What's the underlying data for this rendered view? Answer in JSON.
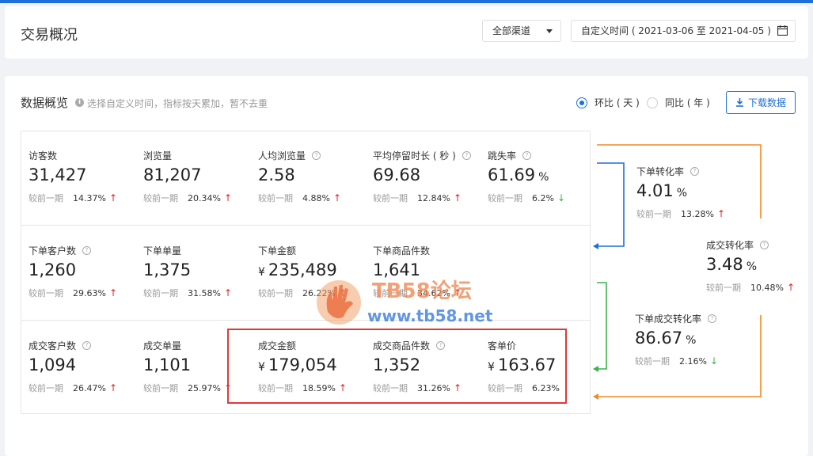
{
  "header": {
    "title": "交易概况",
    "channel": "全部渠道",
    "date_range": "自定义时间 ( 2021-03-06 至 2021-04-05 )"
  },
  "overview": {
    "title": "数据概览",
    "hint": "选择自定义时间，指标按天累加，暂不去重",
    "radio_ring": "环比 ( 天 )",
    "radio_year": "同比 ( 年 )",
    "download": "下载数据"
  },
  "compare_label": "较前一期",
  "metrics": [
    {
      "label": "访客数",
      "value": "31,427",
      "pct": "14.37%",
      "trend": "up",
      "help": false
    },
    {
      "label": "浏览量",
      "value": "81,207",
      "pct": "20.34%",
      "trend": "up",
      "help": false
    },
    {
      "label": "人均浏览量",
      "value": "2.58",
      "pct": "4.88%",
      "trend": "up",
      "help": true
    },
    {
      "label": "平均停留时长 ( 秒 )",
      "value": "69.68",
      "pct": "12.84%",
      "trend": "up",
      "help": true
    },
    {
      "label": "跳失率",
      "value": "61.69",
      "unit": "%",
      "pct": "6.2%",
      "trend": "down",
      "help": true
    },
    {
      "label": "下单客户数",
      "value": "1,260",
      "pct": "29.63%",
      "trend": "up",
      "help": true
    },
    {
      "label": "下单单量",
      "value": "1,375",
      "pct": "31.58%",
      "trend": "up",
      "help": false
    },
    {
      "label": "下单金额",
      "value": "235,489",
      "currency": "¥",
      "pct": "26.22%",
      "trend": "up",
      "help": false
    },
    {
      "label": "下单商品件数",
      "value": "1,641",
      "pct": "34.62%",
      "trend": "up",
      "help": false
    },
    {
      "label": "成交客户数",
      "value": "1,094",
      "pct": "26.47%",
      "trend": "up",
      "help": true
    },
    {
      "label": "成交单量",
      "value": "1,101",
      "pct": "25.97%",
      "trend": "up",
      "help": false
    },
    {
      "label": "成交金额",
      "value": "179,054",
      "currency": "¥",
      "pct": "18.59%",
      "trend": "up",
      "help": false
    },
    {
      "label": "成交商品件数",
      "value": "1,352",
      "pct": "31.26%",
      "trend": "up",
      "help": true
    },
    {
      "label": "客单价",
      "value": "163.67",
      "currency": "¥",
      "pct": "6.23%",
      "trend": "",
      "help": false
    }
  ],
  "conversions": [
    {
      "label": "下单转化率",
      "value": "4.01",
      "unit": "%",
      "pct": "13.28%",
      "trend": "up"
    },
    {
      "label": "成交转化率",
      "value": "3.48",
      "unit": "%",
      "pct": "10.48%",
      "trend": "up"
    },
    {
      "label": "下单成交转化率",
      "value": "86.67",
      "unit": "%",
      "pct": "2.16%",
      "trend": "down"
    }
  ],
  "watermark": {
    "brand": "TB58论坛",
    "url": "www.tb58.net"
  },
  "colors": {
    "primary": "#1e6fd9",
    "up": "#e02020",
    "down": "#3bb34a",
    "flow_orange": "#f08a24",
    "flow_blue": "#1e6fd9",
    "flow_green": "#3bb34a",
    "highlight": "#e03838"
  }
}
